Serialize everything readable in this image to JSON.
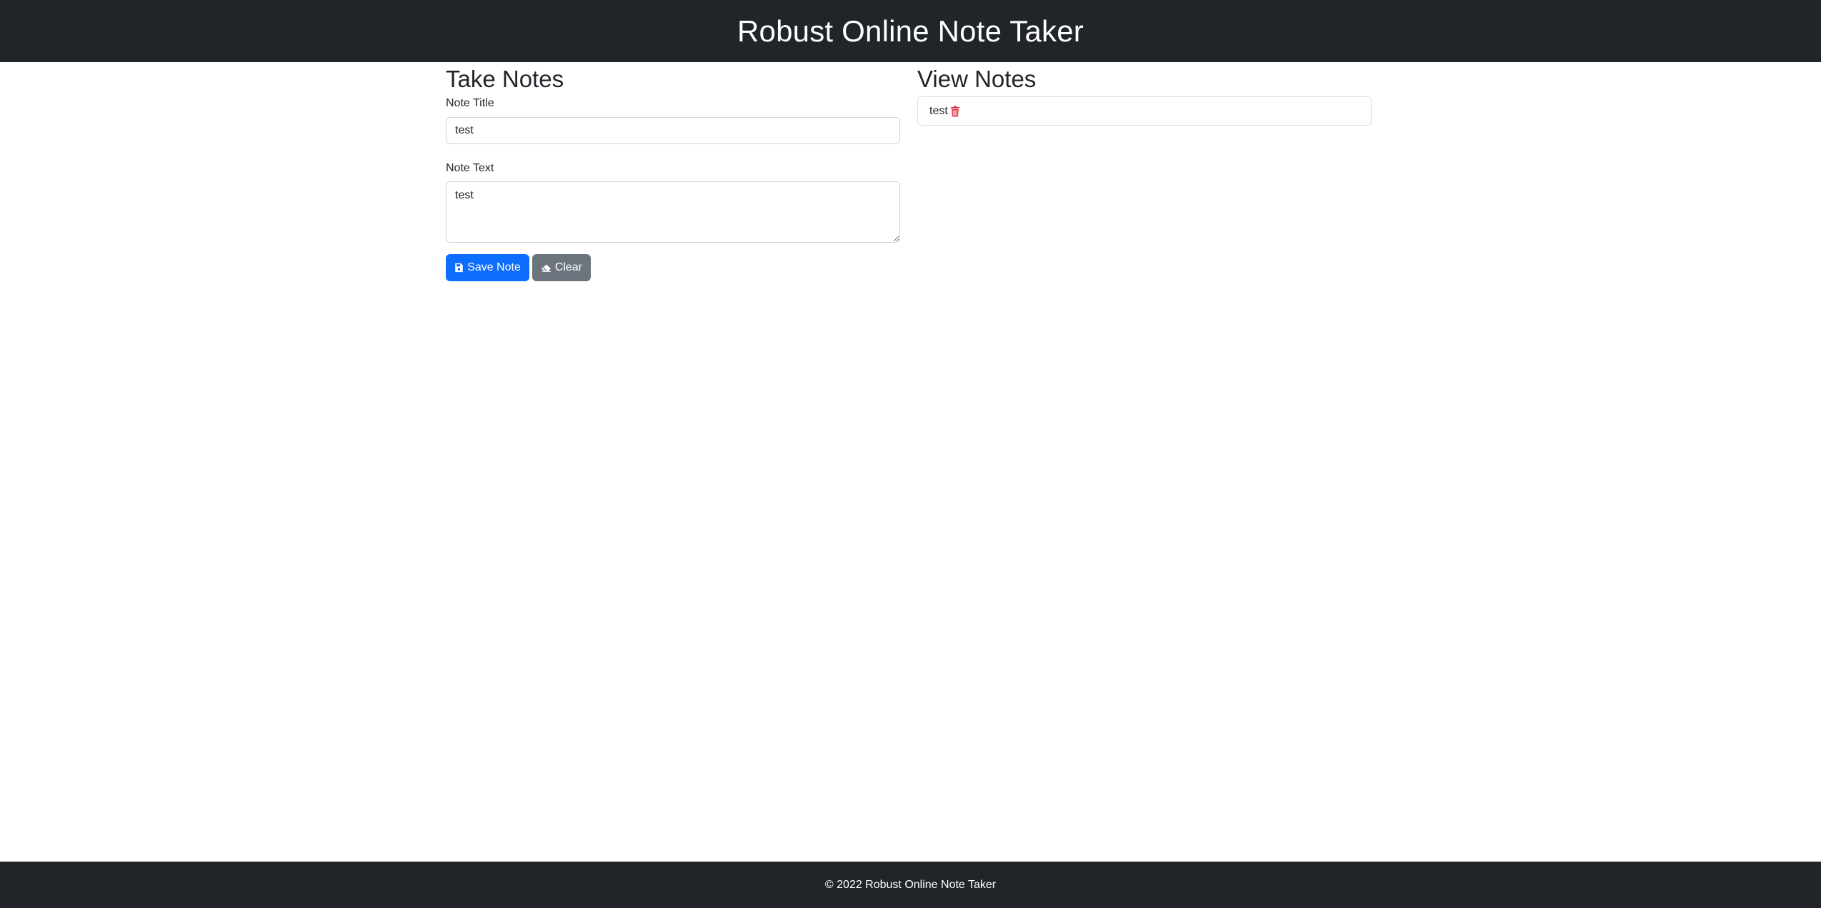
{
  "header": {
    "title": "Robust Online Note Taker"
  },
  "take_notes": {
    "heading": "Take Notes",
    "title_label": "Note Title",
    "title_value": "test",
    "text_label": "Note Text",
    "text_value": "test",
    "save_label": "Save Note",
    "clear_label": "Clear"
  },
  "view_notes": {
    "heading": "View Notes",
    "items": [
      {
        "title": "test"
      }
    ]
  },
  "footer": {
    "text": "© 2022 Robust Online Note Taker"
  },
  "colors": {
    "navbar": "#212529",
    "primary": "#0d6efd",
    "secondary": "#6c757d",
    "danger": "#dc3545"
  },
  "icons": {
    "save": "floppy-disk-icon",
    "clear": "eraser-icon",
    "delete": "trash-icon"
  }
}
